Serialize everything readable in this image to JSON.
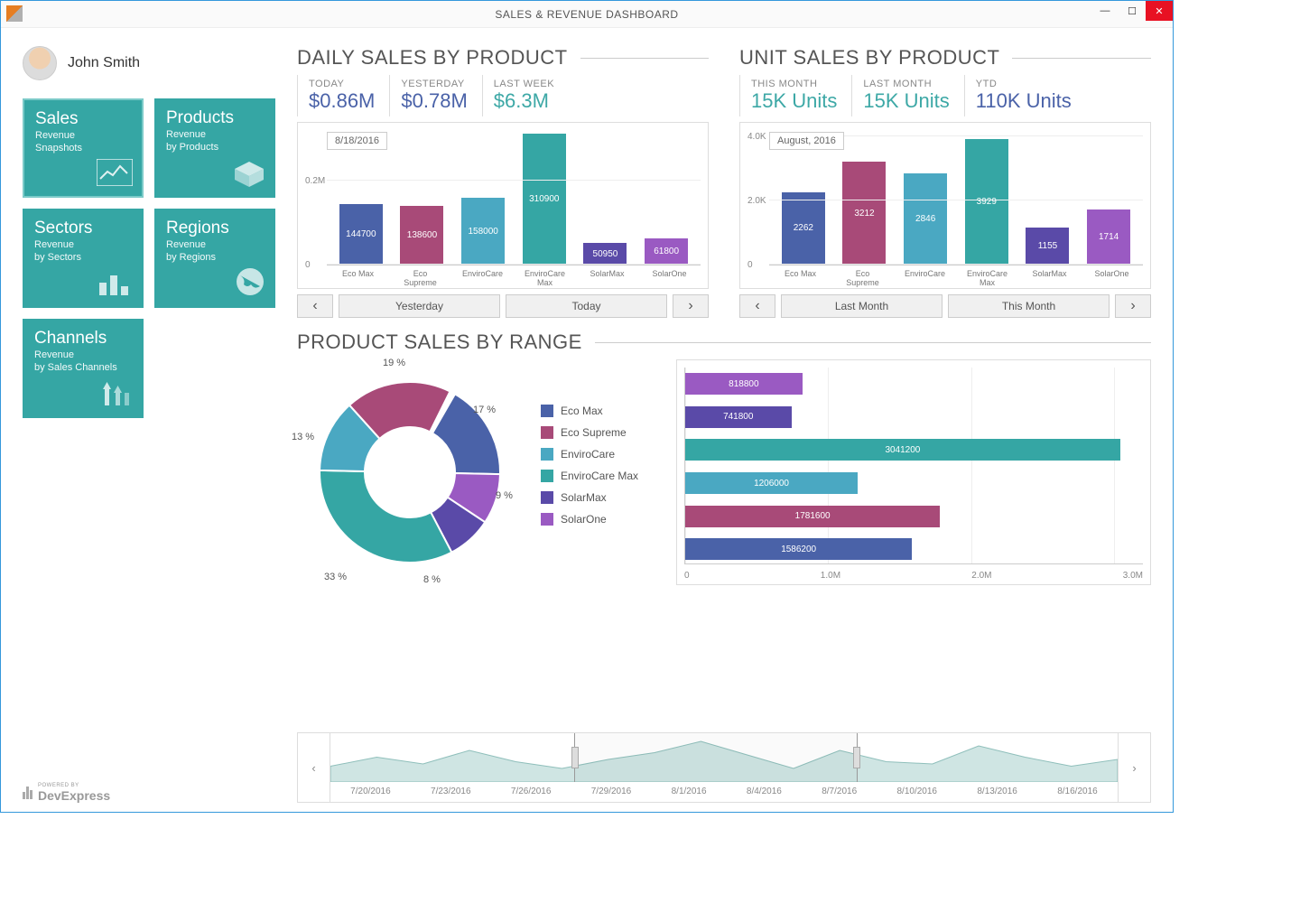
{
  "window": {
    "title": "SALES & REVENUE DASHBOARD"
  },
  "user": {
    "name": "John Smith"
  },
  "tiles": [
    {
      "title": "Sales",
      "sub1": "Revenue",
      "sub2": "Snapshots",
      "selected": true,
      "icon": "chart-line"
    },
    {
      "title": "Products",
      "sub1": "Revenue",
      "sub2": "by Products",
      "icon": "box"
    },
    {
      "title": "Sectors",
      "sub1": "Revenue",
      "sub2": "by Sectors",
      "icon": "bars"
    },
    {
      "title": "Regions",
      "sub1": "Revenue",
      "sub2": "by Regions",
      "icon": "globe"
    },
    {
      "title": "Channels",
      "sub1": "Revenue",
      "sub2": "by Sales Channels",
      "icon": "routes"
    }
  ],
  "daily": {
    "title": "DAILY SALES BY PRODUCT",
    "metrics": [
      {
        "label": "TODAY",
        "value": "$0.86M",
        "cls": "m-blue"
      },
      {
        "label": "YESTERDAY",
        "value": "$0.78M",
        "cls": "m-blue"
      },
      {
        "label": "LAST WEEK",
        "value": "$6.3M",
        "cls": "m-teal"
      }
    ],
    "date_tag": "8/18/2016",
    "nav": {
      "prev": "Yesterday",
      "next": "Today"
    }
  },
  "unit": {
    "title": "UNIT SALES BY PRODUCT",
    "metrics": [
      {
        "label": "THIS MONTH",
        "value": "15K Units",
        "cls": "m-teal"
      },
      {
        "label": "LAST MONTH",
        "value": "15K Units",
        "cls": "m-teal"
      },
      {
        "label": "YTD",
        "value": "110K Units",
        "cls": "m-blue"
      }
    ],
    "date_tag": "August, 2016",
    "nav": {
      "prev": "Last Month",
      "next": "This Month"
    }
  },
  "range": {
    "title": "PRODUCT SALES BY RANGE"
  },
  "colors": {
    "Eco Max": "#4a62a8",
    "Eco Supreme": "#a84a78",
    "EnviroCare": "#4aa8c2",
    "EnviroCare Max": "#35a6a4",
    "SolarMax": "#5a4aa8",
    "SolarOne": "#9a5ac2"
  },
  "legend": [
    "Eco Max",
    "Eco Supreme",
    "EnviroCare",
    "EnviroCare Max",
    "SolarMax",
    "SolarOne"
  ],
  "chart_data": [
    {
      "id": "daily_bar",
      "type": "bar",
      "title": "Daily Sales By Product",
      "categories": [
        "Eco Max",
        "Eco Supreme",
        "EnviroCare",
        "EnviroCare Max",
        "SolarMax",
        "SolarOne"
      ],
      "values": [
        144700,
        138600,
        158000,
        310900,
        50950,
        61800
      ],
      "ylim": [
        0,
        320000
      ],
      "yticks": [
        0,
        200000
      ],
      "ytick_labels": [
        "0",
        "0.2M"
      ],
      "date": "8/18/2016"
    },
    {
      "id": "unit_bar",
      "type": "bar",
      "title": "Unit Sales By Product",
      "categories": [
        "Eco Max",
        "Eco Supreme",
        "EnviroCare",
        "EnviroCare Max",
        "SolarMax",
        "SolarOne"
      ],
      "values": [
        2262,
        3212,
        2846,
        3929,
        1155,
        1714
      ],
      "ylim": [
        0,
        4200
      ],
      "yticks": [
        0,
        2000,
        4000
      ],
      "ytick_labels": [
        "0",
        "2.0K",
        "4.0K"
      ],
      "date": "August, 2016"
    },
    {
      "id": "range_donut",
      "type": "pie",
      "title": "Product Sales By Range (share)",
      "series": [
        {
          "name": "Eco Max",
          "pct": 17
        },
        {
          "name": "Eco Supreme",
          "pct": 19
        },
        {
          "name": "EnviroCare",
          "pct": 13
        },
        {
          "name": "EnviroCare Max",
          "pct": 33
        },
        {
          "name": "SolarMax",
          "pct": 8
        },
        {
          "name": "SolarOne",
          "pct": 9
        }
      ]
    },
    {
      "id": "range_hbar",
      "type": "bar",
      "orientation": "horizontal",
      "categories": [
        "SolarOne",
        "SolarMax",
        "EnviroCare Max",
        "EnviroCare",
        "Eco Supreme",
        "Eco Max"
      ],
      "values": [
        818800,
        741800,
        3041200,
        1206000,
        1781600,
        1586200
      ],
      "xlim": [
        0,
        3200000
      ],
      "xticks": [
        0,
        1000000,
        2000000,
        3000000
      ],
      "xtick_labels": [
        "0",
        "1.0M",
        "2.0M",
        "3.0M"
      ]
    },
    {
      "id": "timeline",
      "type": "area",
      "x": [
        "7/20/2016",
        "7/23/2016",
        "7/26/2016",
        "7/29/2016",
        "8/1/2016",
        "8/4/2016",
        "8/7/2016",
        "8/10/2016",
        "8/13/2016",
        "8/16/2016"
      ],
      "values": [
        0.35,
        0.55,
        0.4,
        0.7,
        0.45,
        0.3,
        0.5,
        0.65,
        0.9,
        0.6,
        0.3,
        0.7,
        0.45,
        0.4,
        0.8,
        0.55,
        0.35,
        0.5
      ],
      "selection": {
        "start": "7/29/2016",
        "end": "8/8/2016"
      }
    }
  ],
  "timeline_dates": [
    "7/20/2016",
    "7/23/2016",
    "7/26/2016",
    "7/29/2016",
    "8/1/2016",
    "8/4/2016",
    "8/7/2016",
    "8/10/2016",
    "8/13/2016",
    "8/16/2016"
  ],
  "footer": {
    "powered": "POWERED BY",
    "brand": "DevExpress"
  }
}
